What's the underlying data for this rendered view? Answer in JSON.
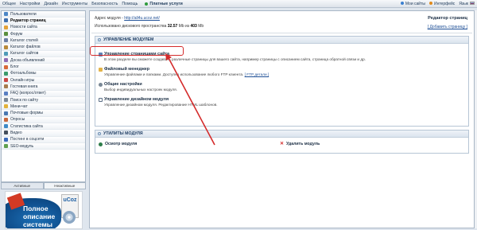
{
  "topbar": {
    "menu": [
      "Общее",
      "Настройки",
      "Дизайн",
      "Инструменты",
      "Безопасность",
      "Помощь"
    ],
    "paid_label": "Платные услуги",
    "right": [
      "Мои сайты",
      "Интерфейс",
      "Язык"
    ],
    "colors": {
      "paid_dot": "#2e9b3c",
      "sites_dot": "#3a7fd0",
      "ui_dot": "#e08a1c"
    }
  },
  "sidebar": {
    "items": [
      {
        "label": "Пользователи",
        "icon": "users-icon",
        "color": "#4c86c6",
        "active": false
      },
      {
        "label": "Редактор страниц",
        "icon": "pages-icon",
        "color": "#3f6fae",
        "active": true
      },
      {
        "label": "Новости сайта",
        "icon": "news-icon",
        "color": "#e3a23a",
        "active": false
      },
      {
        "label": "Форум",
        "icon": "forum-icon",
        "color": "#5a8f3d",
        "active": false
      },
      {
        "label": "Каталог статей",
        "icon": "articles-icon",
        "color": "#6b7fa5",
        "active": false
      },
      {
        "label": "Каталог файлов",
        "icon": "files-icon",
        "color": "#b88a3a",
        "active": false
      },
      {
        "label": "Каталог сайтов",
        "icon": "sites-icon",
        "color": "#4f9bb8",
        "active": false
      },
      {
        "label": "Доска объявлений",
        "icon": "board-icon",
        "color": "#8e6bb5",
        "active": false
      },
      {
        "label": "Блог",
        "icon": "blog-icon",
        "color": "#d7693a",
        "active": false
      },
      {
        "label": "Фотоальбомы",
        "icon": "photo-icon",
        "color": "#3b9a6c",
        "active": false
      },
      {
        "label": "Онлайн игры",
        "icon": "games-icon",
        "color": "#c94646",
        "active": false
      },
      {
        "label": "Гостевая книга",
        "icon": "guestbook-icon",
        "color": "#a57b4e",
        "active": false
      },
      {
        "label": "FAQ (вопрос/ответ)",
        "icon": "faq-icon",
        "color": "#5a7fc2",
        "active": false
      },
      {
        "label": "Поиск по сайту",
        "icon": "search-icon",
        "color": "#7a8896",
        "active": false
      },
      {
        "label": "Мини-чат",
        "icon": "chat-icon",
        "color": "#e2b23b",
        "active": false
      },
      {
        "label": "Почтовые формы",
        "icon": "mail-icon",
        "color": "#4a78b1",
        "active": false
      },
      {
        "label": "Опросы",
        "icon": "polls-icon",
        "color": "#c9683d",
        "active": false
      },
      {
        "label": "Статистика сайта",
        "icon": "stats-icon",
        "color": "#3e8ac7",
        "active": false
      },
      {
        "label": "Видео",
        "icon": "video-icon",
        "color": "#444f5d",
        "active": false
      },
      {
        "label": "Постинг в соцсети",
        "icon": "social-icon",
        "color": "#3a6bbb",
        "active": false
      },
      {
        "label": "SEO-модуль",
        "icon": "seo-icon",
        "color": "#5fa04e",
        "active": false
      }
    ],
    "tabs": [
      "Активные",
      "Неактивные"
    ]
  },
  "banner": {
    "line1": "Полное",
    "line2": "описание",
    "line3": "системы",
    "logo": "uCoz"
  },
  "info": {
    "address_label": "Адрес модуля - ",
    "address_link": "http://all4u.ucoz.net/",
    "usage_prefix": "Использовано дискового пространства ",
    "used": "32.57",
    "used_unit": " Mb из ",
    "total": "403",
    "total_unit": " Mb",
    "page_title": "Редактор страниц",
    "add_page": "[ Добавить страницу ]"
  },
  "manage": {
    "title": "УПРАВЛЕНИЕ МОДУЛЕМ",
    "entries": [
      {
        "title": "Управление страницами сайта",
        "desc": "В этом разделе вы сможете создавать различные страницы для вашего сайта, например страницы с описанием сайта, страница обратной связи и др.",
        "icon": "page-manage-icon"
      },
      {
        "title": "Файловый менеджер",
        "desc": "Управление файлами и папками. Доступно использование любого FTP клиента. ",
        "desc_link": "[ FTP детали ]",
        "icon": "folder-icon"
      },
      {
        "title": "Общие настройки",
        "desc": "Выбор индивидуальных настроек модуля.",
        "icon": "settings-icon"
      },
      {
        "title": "Управление дизайном модуля",
        "desc": "Управление дизайном модуля. Редактирование HTML шаблонов.",
        "icon": "design-icon"
      }
    ]
  },
  "utils": {
    "title": "УТИЛИТЫ МОДУЛЯ",
    "view": "Осмотр модуля",
    "delete": "Удалить модуль"
  },
  "annotation": {
    "color": "#d42b2b"
  }
}
